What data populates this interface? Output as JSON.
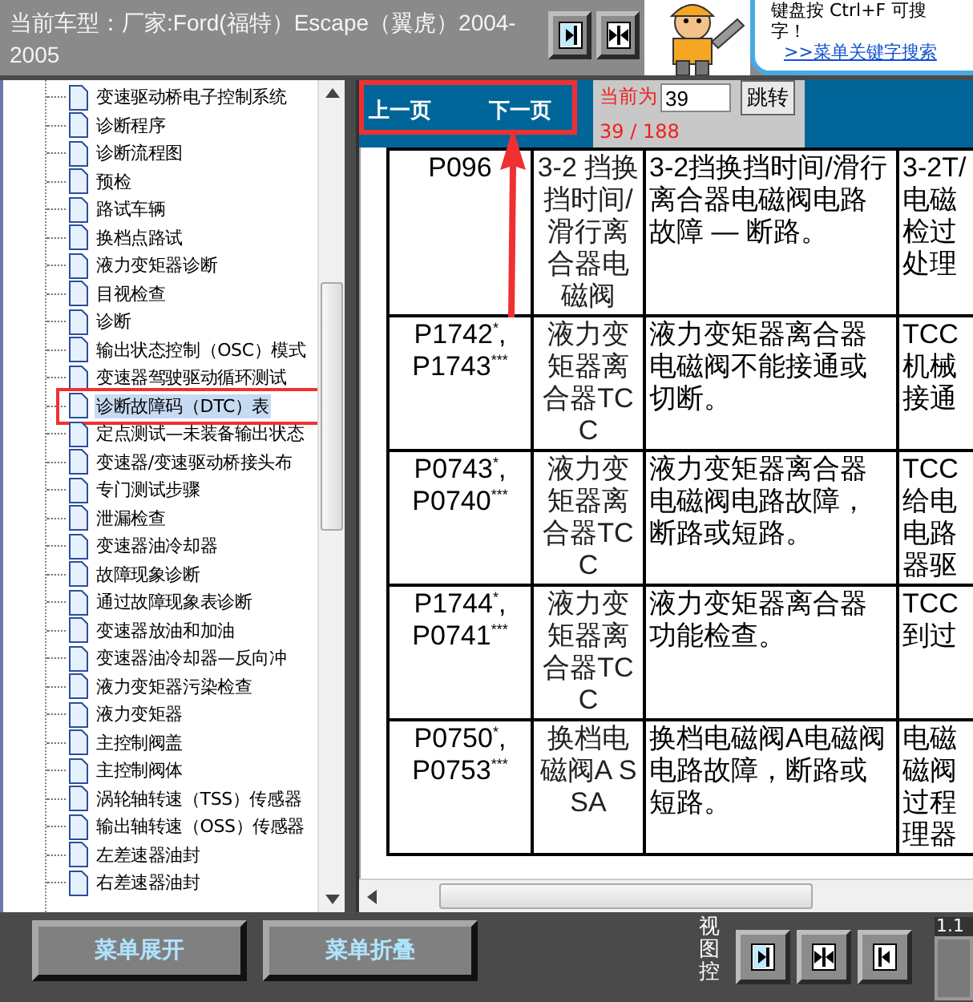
{
  "header": {
    "vehicle": "当前车型：厂家:Ford(福特）Escape（翼虎）2004-2005"
  },
  "tip": {
    "line_1": "键盘按 Ctrl+F 可搜",
    "line_2": "字！",
    "link": ">>菜单关键字搜索"
  },
  "tree": {
    "items": [
      {
        "label": "变速驱动桥电子控制系统",
        "selected": false
      },
      {
        "label": "诊断程序",
        "selected": false
      },
      {
        "label": "诊断流程图",
        "selected": false
      },
      {
        "label": "预检",
        "selected": false
      },
      {
        "label": "路试车辆",
        "selected": false
      },
      {
        "label": "换档点路试",
        "selected": false
      },
      {
        "label": "液力变矩器诊断",
        "selected": false
      },
      {
        "label": "目视检查",
        "selected": false
      },
      {
        "label": "诊断",
        "selected": false
      },
      {
        "label": "输出状态控制（OSC）模式",
        "selected": false
      },
      {
        "label": "变速器驾驶驱动循环测试",
        "selected": false
      },
      {
        "label": "诊断故障码（DTC）表",
        "selected": true
      },
      {
        "label": "定点测试—未装备输出状态",
        "selected": false
      },
      {
        "label": "变速器/变速驱动桥接头布",
        "selected": false
      },
      {
        "label": "专门测试步骤",
        "selected": false
      },
      {
        "label": "泄漏检查",
        "selected": false
      },
      {
        "label": "变速器油冷却器",
        "selected": false
      },
      {
        "label": "故障现象诊断",
        "selected": false
      },
      {
        "label": "通过故障现象表诊断",
        "selected": false
      },
      {
        "label": "变速器放油和加油",
        "selected": false
      },
      {
        "label": "变速器油冷却器—反向冲",
        "selected": false
      },
      {
        "label": "液力变矩器污染检查",
        "selected": false
      },
      {
        "label": "液力变矩器",
        "selected": false
      },
      {
        "label": "主控制阀盖",
        "selected": false
      },
      {
        "label": "主控制阀体",
        "selected": false
      },
      {
        "label": "涡轮轴转速（TSS）传感器",
        "selected": false
      },
      {
        "label": "输出轴转速（OSS）传感器",
        "selected": false
      },
      {
        "label": "左差速器油封",
        "selected": false
      },
      {
        "label": "右差速器油封",
        "selected": false
      }
    ]
  },
  "nav": {
    "prev": "上一页",
    "next": "下一页",
    "current_label": "当前为",
    "page_value": "39",
    "go": "跳转",
    "page_count": "39 / 188"
  },
  "table": {
    "rows": [
      {
        "code": [
          "P096"
        ],
        "component": "3-2 挡换挡时间/滑行离合器电磁阀",
        "description": "3-2挡换挡时间/滑行离合器电磁阀电路故障 — 断路。",
        "column_4": "3-2T/电磁检过处理"
      },
      {
        "code": [
          "P1742$^{*}$,",
          "P1743$^{***}$"
        ],
        "component": "液力变矩器离合器TCC",
        "description": "液力变矩器离合器电磁阀不能接通或切断。",
        "column_4": "TCC机械接通"
      },
      {
        "code": [
          "P0743$^{*}$,",
          "P0740$^{***}$"
        ],
        "component": "液力变矩器离合器TCC",
        "description": "液力变矩器离合器电磁阀电路故障，断路或短路。",
        "column_4": "TCC给电电路器驱"
      },
      {
        "code": [
          "P1744$^{*}$,",
          "P0741$^{***}$"
        ],
        "component": "液力变矩器离合器TCC",
        "description": "液力变矩器离合器功能检查。",
        "column_4": "TCC到过"
      },
      {
        "code": [
          "P0750$^{*}$,",
          "P0753$^{***}$"
        ],
        "component": "换档电磁阀A SSA",
        "description": "换档电磁阀A电磁阀电路故障，断路或短路。",
        "column_4": "电磁磁阀过程理器"
      }
    ]
  },
  "bottom": {
    "expand": "菜单展开",
    "collapse": "菜单折叠",
    "view_label": "视图控",
    "version": "1.1"
  }
}
